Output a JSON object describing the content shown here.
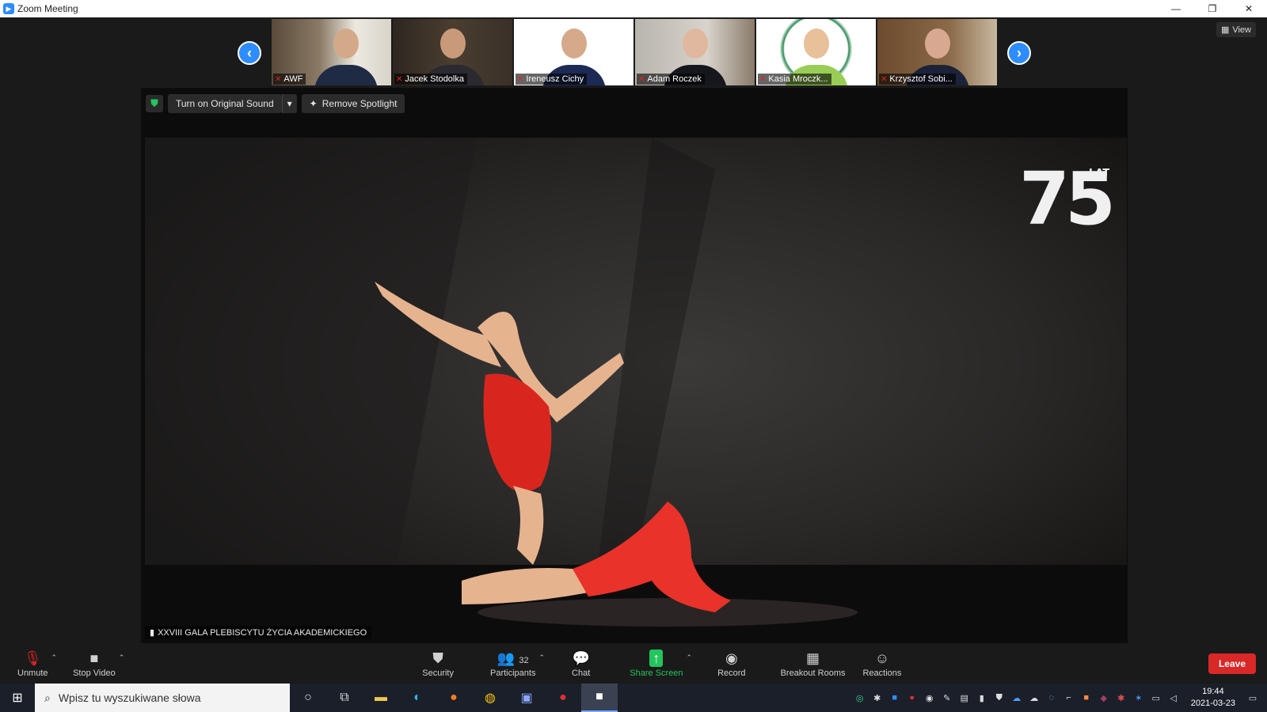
{
  "window": {
    "title": "Zoom Meeting",
    "icon": "zoom-icon"
  },
  "view": {
    "label": "View"
  },
  "participants": [
    {
      "name": "AWF"
    },
    {
      "name": "Jacek Stodolka"
    },
    {
      "name": "Ireneusz Cichy"
    },
    {
      "name": "Adam Roczek"
    },
    {
      "name": "Kasia Mroczk..."
    },
    {
      "name": "Krzysztof Sobi..."
    }
  ],
  "stage": {
    "original_sound": "Turn on Original Sound",
    "remove_spotlight": "Remove Spotlight",
    "logo_number": "75",
    "logo_lat": "LAT",
    "caption": "XXVIII GALA PLEBISCYTU ŻYCIA AKADEMICKIEGO"
  },
  "controls": {
    "unmute": "Unmute",
    "stop_video": "Stop Video",
    "security": "Security",
    "participants": "Participants",
    "participants_count": "32",
    "chat": "Chat",
    "share_screen": "Share Screen",
    "record": "Record",
    "breakout_rooms": "Breakout Rooms",
    "reactions": "Reactions",
    "leave": "Leave"
  },
  "taskbar": {
    "search_placeholder": "Wpisz tu wyszukiwane słowa",
    "time": "19:44",
    "date": "2021-03-23"
  },
  "colors": {
    "accent": "#2d8cff",
    "leave": "#d92828",
    "share": "#22c55e"
  }
}
